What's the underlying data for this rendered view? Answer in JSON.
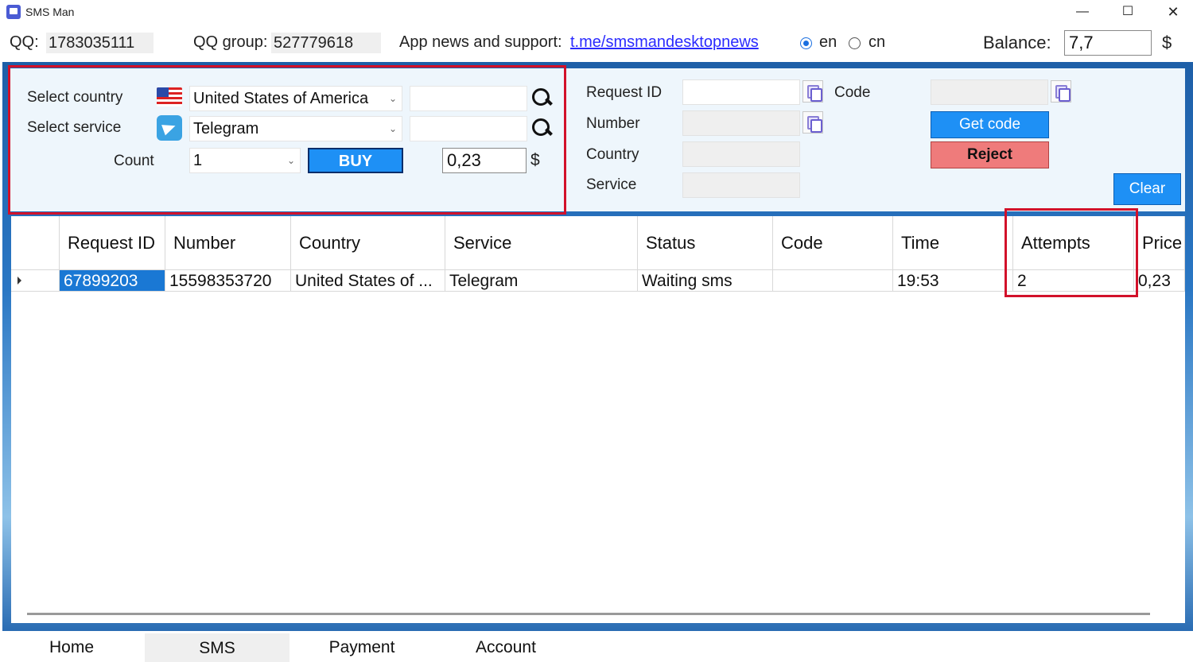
{
  "window": {
    "title": "SMS Man",
    "minimize_glyph": "—",
    "maximize_glyph": "☐",
    "close_glyph": "✕"
  },
  "info_bar": {
    "qq_label": "QQ:",
    "qq_value": "1783035111",
    "qq_group_label": "QQ group:",
    "qq_group_value": "527779618",
    "news_label": "App news and support:",
    "news_link": "t.me/smsmandesktopnews",
    "lang_en": "en",
    "lang_cn": "cn",
    "selected_lang": "en",
    "balance_label": "Balance:",
    "balance_value": "7,7",
    "currency": "$"
  },
  "buy_panel": {
    "country_label": "Select country",
    "country_value": "United States of America",
    "service_label": "Select service",
    "service_value": "Telegram",
    "count_label": "Count",
    "count_value": "1",
    "buy_button": "BUY",
    "price_value": "0,23",
    "currency": "$"
  },
  "receive_panel": {
    "request_id_label": "Request ID",
    "number_label": "Number",
    "country_label": "Country",
    "service_label": "Service",
    "code_label": "Code",
    "get_code_button": "Get code",
    "reject_button": "Reject",
    "clear_button": "Clear"
  },
  "table": {
    "columns": [
      "Request ID",
      "Number",
      "Country",
      "Service",
      "Status",
      "Code",
      "Time",
      "Attempts",
      "Price"
    ],
    "rows": [
      {
        "request_id": "67899203",
        "number": "15598353720",
        "country": "United States of ...",
        "service": "Telegram",
        "status": "Waiting sms",
        "code": "",
        "time": "19:53",
        "attempts": "2",
        "price": "0,23"
      }
    ]
  },
  "tabs": [
    "Home",
    "SMS",
    "Payment",
    "Account"
  ],
  "active_tab": "SMS",
  "colors": {
    "accent_blue": "#1e90f5",
    "reject_red": "#ef7b7b",
    "highlight_red": "#d2112a",
    "selection_blue": "#1a78d4"
  }
}
